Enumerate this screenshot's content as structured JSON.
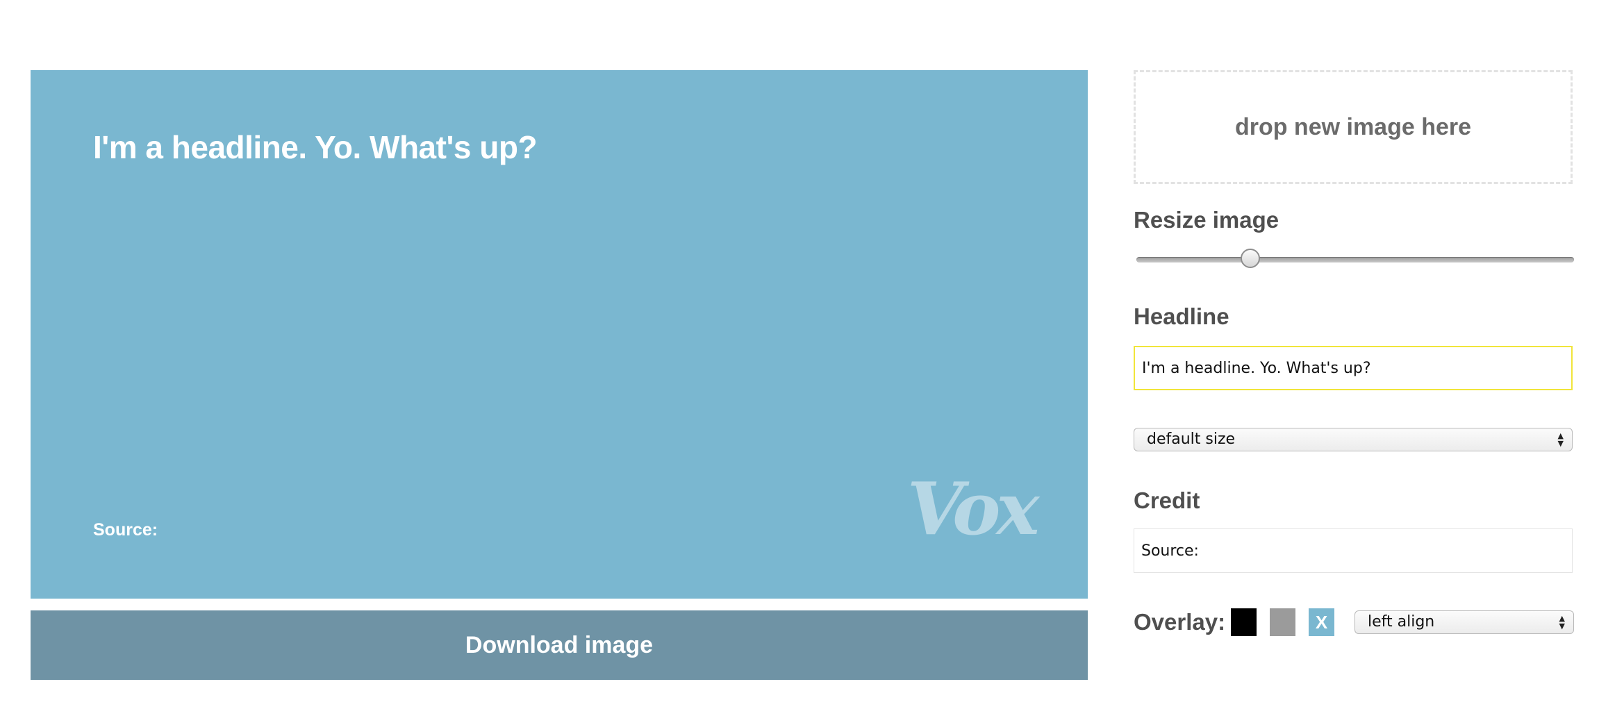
{
  "canvas": {
    "headline": "I'm a headline. Yo. What's up?",
    "credit": "Source:",
    "logo": "Vox",
    "background_color": "#7ab7d0"
  },
  "download_button": {
    "label": "Download image"
  },
  "dropzone": {
    "label": "drop new image here"
  },
  "resize": {
    "label": "Resize image",
    "value_fraction": 0.26
  },
  "headline": {
    "label": "Headline",
    "value": "I'm a headline. Yo. What's up?"
  },
  "size_select": {
    "selected": "default size"
  },
  "credit": {
    "label": "Credit",
    "value": "Source:"
  },
  "overlay": {
    "label": "Overlay:",
    "swatches": [
      {
        "name": "black",
        "color": "#000000",
        "text": ""
      },
      {
        "name": "gray",
        "color": "#9b9b9b",
        "text": ""
      },
      {
        "name": "none",
        "color": "#7ab7d0",
        "text": "X"
      }
    ],
    "align_selected": "left align"
  },
  "icons": {
    "select_arrows": "updown-arrows-icon"
  }
}
